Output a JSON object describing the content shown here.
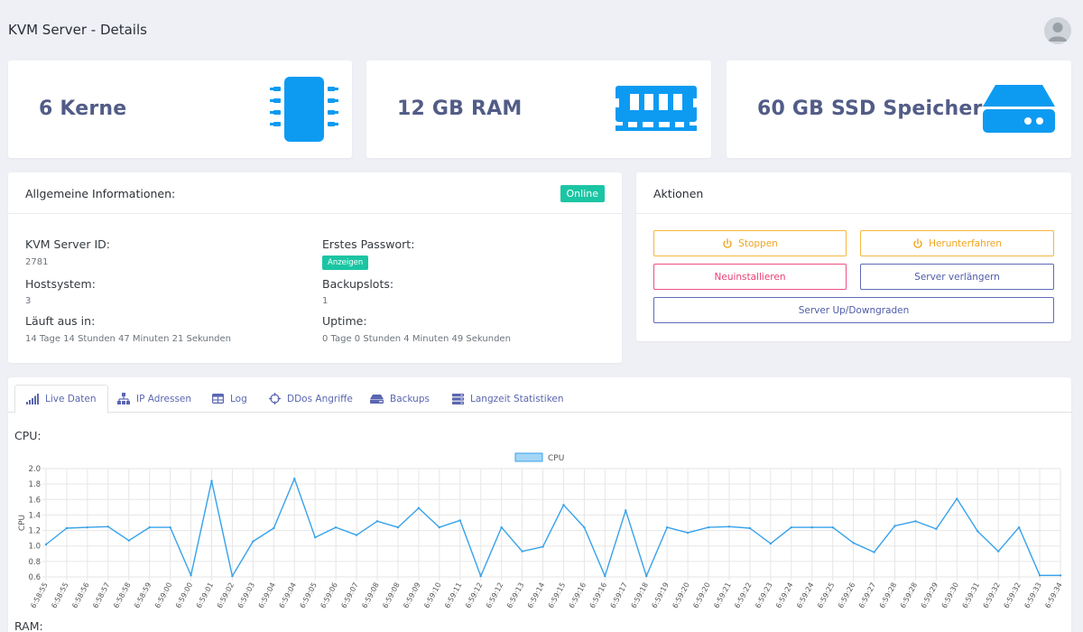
{
  "header": {
    "title": "KVM Server - Details"
  },
  "stats": [
    {
      "value": "6 Kerne",
      "icon": "cpu-chip-icon"
    },
    {
      "value": "12 GB RAM",
      "icon": "memory-module-icon"
    },
    {
      "value": "60 GB SSD Speicher",
      "icon": "hard-drive-icon"
    }
  ],
  "info": {
    "title": "Allgemeine Informationen:",
    "status": "Online",
    "server_id_label": "KVM Server ID:",
    "server_id": "2781",
    "password_label": "Erstes Passwort:",
    "password_button": "Anzeigen",
    "host_label": "Hostsystem:",
    "host": "3",
    "backup_label": "Backupslots:",
    "backup": "1",
    "expires_label": "Läuft aus in:",
    "expires": "14 Tage 14 Stunden 47 Minuten 21 Sekunden",
    "uptime_label": "Uptime:",
    "uptime": "0 Tage 0 Stunden 4 Minuten 49 Sekunden"
  },
  "actions": {
    "title": "Aktionen",
    "stop": "Stoppen",
    "shutdown": "Herunterfahren",
    "reinstall": "Neuinstallieren",
    "extend": "Server verlängern",
    "updown": "Server Up/Downgraden"
  },
  "tabs": [
    {
      "label": "Live Daten",
      "icon": "signal-bars-icon"
    },
    {
      "label": "IP Adressen",
      "icon": "network-icon"
    },
    {
      "label": "Log",
      "icon": "table-icon"
    },
    {
      "label": "DDos Angriffe",
      "icon": "crosshair-icon"
    },
    {
      "label": "Backups",
      "icon": "hdd-icon"
    },
    {
      "label": "Langzeit Statistiken",
      "icon": "server-stack-icon"
    }
  ],
  "sections": {
    "cpu": "CPU:",
    "ram": "RAM:"
  },
  "colors": {
    "accent": "#0d9bf2",
    "stat_text": "#525c86",
    "online": "#1bc5a3",
    "warning": "#f5b63e",
    "danger": "#f05080",
    "indigo": "#5e6bb8",
    "line": "#36a2eb"
  },
  "chart_data": {
    "type": "line",
    "ylabel": "CPU",
    "ylim": [
      0.6,
      2.0
    ],
    "yticks": [
      "2.0",
      "1.8",
      "1.6",
      "1.4",
      "1.2",
      "1.0",
      "0.8",
      "0.6"
    ],
    "grid": true,
    "legend": "top-center",
    "x": [
      "6:58:55",
      "6:58:55",
      "6:58:56",
      "6:58:57",
      "6:58:58",
      "6:58:59",
      "6:59:00",
      "6:59:00",
      "6:59:01",
      "6:59:02",
      "6:59:03",
      "6:59:04",
      "6:59:04",
      "6:59:05",
      "6:59:06",
      "6:59:07",
      "6:59:08",
      "6:59:08",
      "6:59:09",
      "6:59:10",
      "6:59:11",
      "6:59:12",
      "6:59:12",
      "6:59:13",
      "6:59:14",
      "6:59:15",
      "6:59:16",
      "6:59:16",
      "6:59:17",
      "6:59:18",
      "6:59:19",
      "6:59:20",
      "6:59:20",
      "6:59:21",
      "6:59:22",
      "6:59:23",
      "6:59:24",
      "6:59:24",
      "6:59:25",
      "6:59:26",
      "6:59:27",
      "6:59:28",
      "6:59:28",
      "6:59:29",
      "6:59:30",
      "6:59:31",
      "6:59:32",
      "6:59:32",
      "6:59:33",
      "6:59:34"
    ],
    "series": [
      {
        "name": "CPU",
        "values": [
          1.02,
          1.23,
          1.24,
          1.25,
          1.07,
          1.24,
          1.24,
          0.62,
          1.84,
          0.61,
          1.06,
          1.23,
          1.87,
          1.11,
          1.24,
          1.14,
          1.32,
          1.24,
          1.49,
          1.24,
          1.33,
          0.61,
          1.24,
          0.93,
          0.99,
          1.53,
          1.24,
          0.61,
          1.46,
          0.61,
          1.24,
          1.17,
          1.24,
          1.25,
          1.23,
          1.03,
          1.24,
          1.24,
          1.24,
          1.04,
          0.92,
          1.26,
          1.32,
          1.22,
          1.61,
          1.19,
          0.93,
          1.24,
          0.62,
          0.62
        ]
      }
    ]
  }
}
